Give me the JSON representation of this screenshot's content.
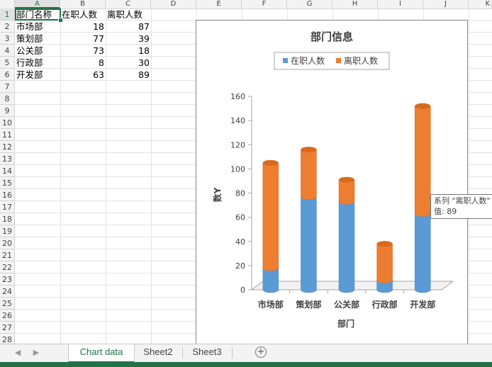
{
  "columns": [
    "A",
    "B",
    "C",
    "D",
    "E",
    "F",
    "G",
    "H",
    "I",
    "J",
    "K"
  ],
  "rows": [
    "1",
    "2",
    "3",
    "4",
    "5",
    "6",
    "7",
    "8",
    "9",
    "10",
    "11",
    "12",
    "13",
    "14",
    "15",
    "16",
    "17",
    "18",
    "19",
    "20",
    "21",
    "22",
    "23",
    "24",
    "25",
    "26",
    "27",
    "28"
  ],
  "table": {
    "headers": [
      "部门名称",
      "在职人数",
      "离职人数"
    ],
    "rows": [
      [
        "市场部",
        "18",
        "87"
      ],
      [
        "策划部",
        "77",
        "39"
      ],
      [
        "公关部",
        "73",
        "18"
      ],
      [
        "行政部",
        "8",
        "30"
      ],
      [
        "开发部",
        "63",
        "89"
      ]
    ]
  },
  "chart_data": {
    "type": "bar",
    "stacked": true,
    "title": "部门信息",
    "xlabel": "部门",
    "ylabel": "数Y",
    "categories": [
      "市场部",
      "策划部",
      "公关部",
      "行政部",
      "开发部"
    ],
    "series": [
      {
        "name": "在职人数",
        "values": [
          18,
          77,
          73,
          8,
          63
        ],
        "color": "#5b9bd5"
      },
      {
        "name": "离职人数",
        "values": [
          87,
          39,
          18,
          30,
          89
        ],
        "color": "#ed7d31"
      }
    ],
    "ylim": [
      0,
      160
    ],
    "yticks": [
      "0",
      "20",
      "40",
      "60",
      "80",
      "100",
      "120",
      "140",
      "160"
    ],
    "legend": "top"
  },
  "tooltip": {
    "line1": "系列 \"离职人数\"",
    "line2": "值: 89"
  },
  "sheets": {
    "tabs": [
      "Chart data",
      "Sheet2",
      "Sheet3"
    ],
    "active": 0,
    "add_symbol": "+"
  },
  "nav": {
    "prev": "◀",
    "next": "▶"
  }
}
